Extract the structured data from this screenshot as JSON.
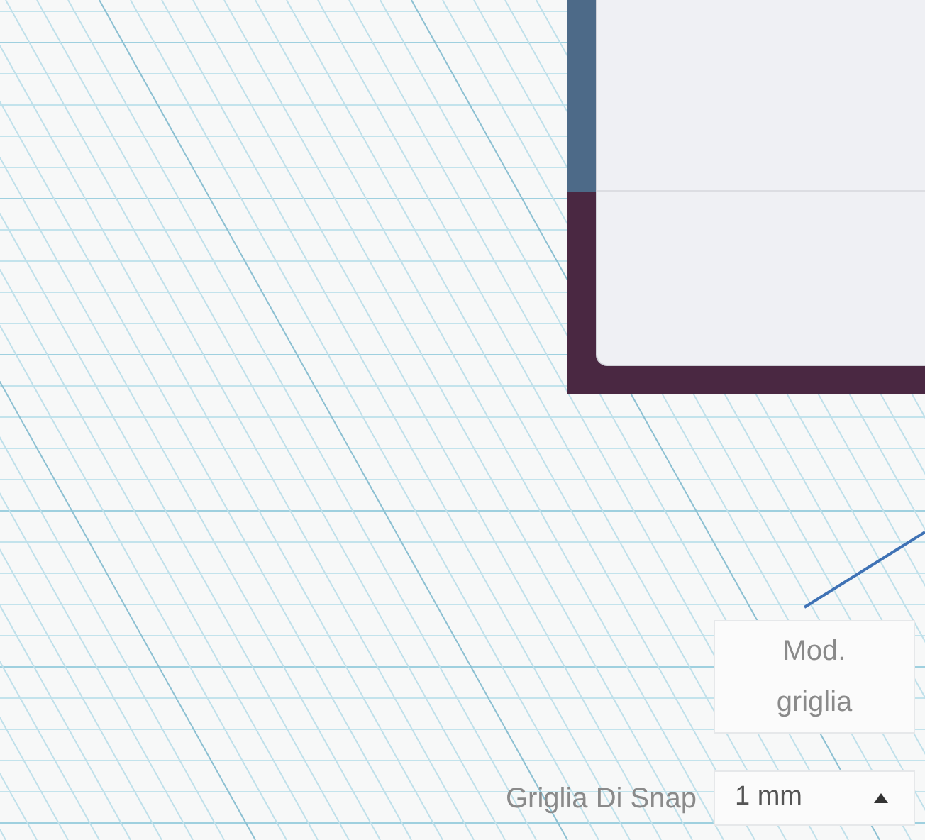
{
  "grid_button": {
    "lines": [
      "Mod.",
      "griglia"
    ]
  },
  "snap_grid": {
    "label": "Griglia Di Snap",
    "value": "1 mm"
  }
}
